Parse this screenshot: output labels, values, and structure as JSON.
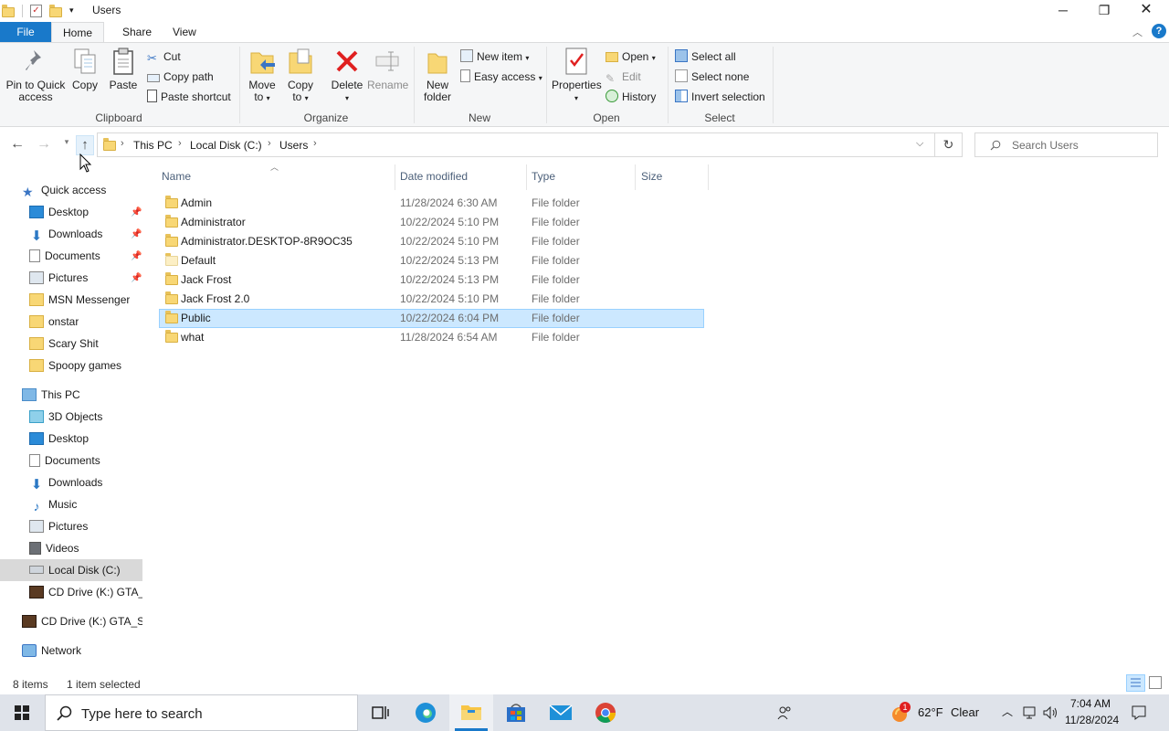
{
  "window": {
    "title": "Users"
  },
  "tabs": {
    "file": "File",
    "home": "Home",
    "share": "Share",
    "view": "View"
  },
  "ribbon": {
    "clipboard": {
      "pin": "Pin to Quick access",
      "pin_l1": "Pin to Quick",
      "pin_l2": "access",
      "copy": "Copy",
      "paste": "Paste",
      "cut": "Cut",
      "copy_path": "Copy path",
      "paste_shortcut": "Paste shortcut",
      "label": "Clipboard"
    },
    "organize": {
      "move_l1": "Move",
      "move_l2": "to",
      "copy_l1": "Copy",
      "copy_l2": "to",
      "delete": "Delete",
      "rename": "Rename",
      "label": "Organize"
    },
    "new": {
      "folder_l1": "New",
      "folder_l2": "folder",
      "new_item": "New item",
      "easy_access": "Easy access",
      "label": "New"
    },
    "open": {
      "properties": "Properties",
      "open": "Open",
      "edit": "Edit",
      "history": "History",
      "label": "Open"
    },
    "select": {
      "all": "Select all",
      "none": "Select none",
      "invert": "Invert selection",
      "label": "Select"
    }
  },
  "address": {
    "crumbs": [
      "This PC",
      "Local Disk (C:)",
      "Users"
    ],
    "search_placeholder": "Search Users"
  },
  "sidebar": {
    "quick_access": "Quick access",
    "quick_items": [
      "Desktop",
      "Downloads",
      "Documents",
      "Pictures",
      "MSN Messenger",
      "onstar",
      "Scary Shit",
      "Spoopy games"
    ],
    "this_pc": "This PC",
    "pc_items": [
      "3D Objects",
      "Desktop",
      "Documents",
      "Downloads",
      "Music",
      "Pictures",
      "Videos",
      "Local Disk (C:)",
      "CD Drive (K:) GTA_S"
    ],
    "cd_drive": "CD Drive (K:) GTA_SA",
    "network": "Network"
  },
  "columns": {
    "name": "Name",
    "date": "Date modified",
    "type": "Type",
    "size": "Size"
  },
  "files": [
    {
      "name": "Admin",
      "date": "11/28/2024 6:30 AM",
      "type": "File folder"
    },
    {
      "name": "Administrator",
      "date": "10/22/2024 5:10 PM",
      "type": "File folder"
    },
    {
      "name": "Administrator.DESKTOP-8R9OC35",
      "date": "10/22/2024 5:10 PM",
      "type": "File folder"
    },
    {
      "name": "Default",
      "date": "10/22/2024 5:13 PM",
      "type": "File folder"
    },
    {
      "name": "Jack Frost",
      "date": "10/22/2024 5:13 PM",
      "type": "File folder"
    },
    {
      "name": "Jack Frost 2.0",
      "date": "10/22/2024 5:10 PM",
      "type": "File folder"
    },
    {
      "name": "Public",
      "date": "10/22/2024 6:04 PM",
      "type": "File folder"
    },
    {
      "name": "what",
      "date": "11/28/2024 6:54 AM",
      "type": "File folder"
    }
  ],
  "status": {
    "count": "8 items",
    "selected": "1 item selected"
  },
  "taskbar": {
    "search": "Type here to search",
    "weather_temp": "62°F",
    "weather_cond": "Clear",
    "weather_badge": "1",
    "time": "7:04 AM",
    "date": "11/28/2024"
  },
  "colors": {
    "accent": "#1979ca",
    "selection": "#cce8ff",
    "folder": "#f8d775"
  }
}
